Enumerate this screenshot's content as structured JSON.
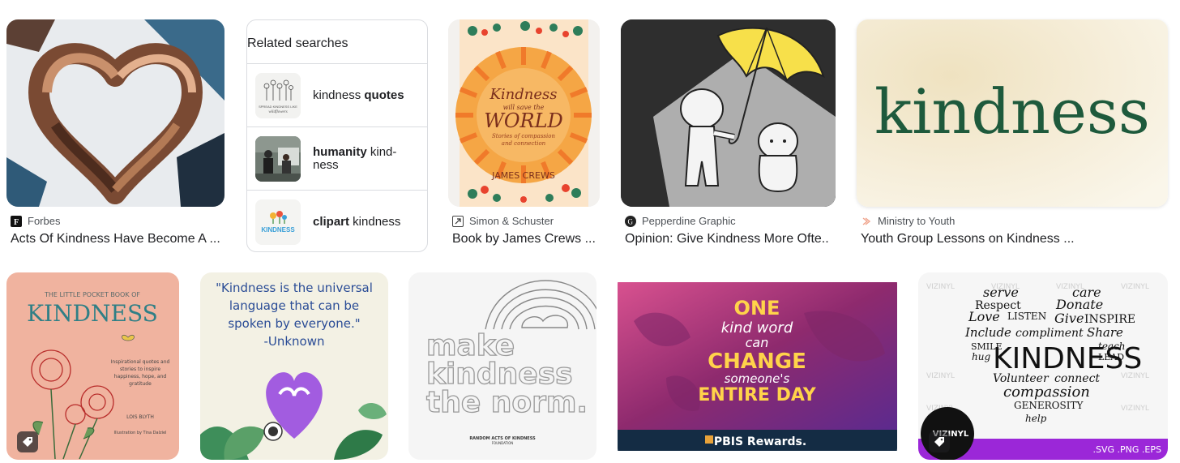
{
  "results_row1": [
    {
      "source": "Forbes",
      "source_icon": "forbes-favicon-icon",
      "title": "Acts Of Kindness Have Become A ..."
    },
    {
      "source": "Simon & Schuster",
      "source_icon": "simon-schuster-favicon-icon",
      "title": "Book by James Crews ...",
      "cover": {
        "line1": "Kindness",
        "line2": "will save the",
        "line3": "WORLD",
        "line4": "Stories of compassion",
        "line5": "and connection",
        "author": "JAMES CREWS"
      }
    },
    {
      "source": "Pepperdine Graphic",
      "source_icon": "pepperdine-favicon-icon",
      "title": "Opinion: Give Kindness More Ofte..."
    },
    {
      "source": "Ministry to Youth",
      "source_icon": "ministry-favicon-icon",
      "title": "Youth Group Lessons on Kindness ...",
      "image_text": "kindness"
    }
  ],
  "related_searches": {
    "heading": "Related searches",
    "items": [
      {
        "plain_before": "kindness ",
        "bold": "quotes",
        "plain_after": ""
      },
      {
        "plain_before": "",
        "bold": "humanity",
        "plain_after": " kind­ness"
      },
      {
        "plain_before": "",
        "bold": "clipart",
        "plain_after": " kindness"
      }
    ],
    "thumb_text": {
      "quote_card": "SPREAD KINDNESS LIKE wildflowers",
      "clipart": "KINDNESS"
    }
  },
  "results_row2": [
    {
      "image": "little-pocket-book",
      "text": {
        "top": "THE LITTLE POCKET BOOK OF",
        "main": "KINDNESS",
        "sub1": "Inspirational quotes and",
        "sub2": "stories to inspire",
        "sub3": "happiness, hope, and",
        "sub4": "gratitude",
        "author": "LOIS BLYTH",
        "illustrator": "Illustration by Tina Dalziel"
      }
    },
    {
      "image": "universal-language-quote",
      "text": {
        "line1": "\"Kindness is the universal",
        "line2": "language that can be",
        "line3": "spoken by everyone.\"",
        "line4": "-Unknown"
      }
    },
    {
      "image": "make-kindness-the-norm",
      "text": {
        "line1": "make",
        "line2": "kindness",
        "line3": "the norm.",
        "org1": "RANDOM ACTS OF KINDNESS",
        "org2": "FOUNDATION"
      }
    },
    {
      "image": "pbis-one-kind-word",
      "text": {
        "l1": "ONE",
        "l2": "kind word",
        "l3": "can",
        "l4": "CHANGE",
        "l5": "someone's",
        "l6": "ENTIRE DAY",
        "footer": "PBIS Rewards."
      }
    },
    {
      "image": "vizinyl-word-cloud",
      "text": {
        "w1": "serve",
        "w2": "Respect",
        "w3": "care",
        "w4": "Donate",
        "w5": "Love",
        "w6": "LISTEN",
        "w7": "Give",
        "w8": "INSPIRE",
        "w9": "Include",
        "w10": "compliment",
        "w11": "Share",
        "w12": "SMILE",
        "w13": "teach",
        "w14": "hug",
        "w15": "KINDNESS",
        "w16": "LEAD",
        "w17": "Volunteer",
        "w18": "connect",
        "w19": "compassion",
        "w20": "GENEROSITY",
        "w21": "help",
        "brand": "VIZINYL",
        "formats": ".SVG   .PNG   .EPS"
      }
    }
  ],
  "colors": {
    "pbis_purple": "#8e2a6e",
    "vizinyl_purple": "#9b27d8",
    "book_orange": "#f07a2a",
    "pepperdine_yellow": "#f7e04a",
    "kindness_green": "#1e5a3c"
  }
}
